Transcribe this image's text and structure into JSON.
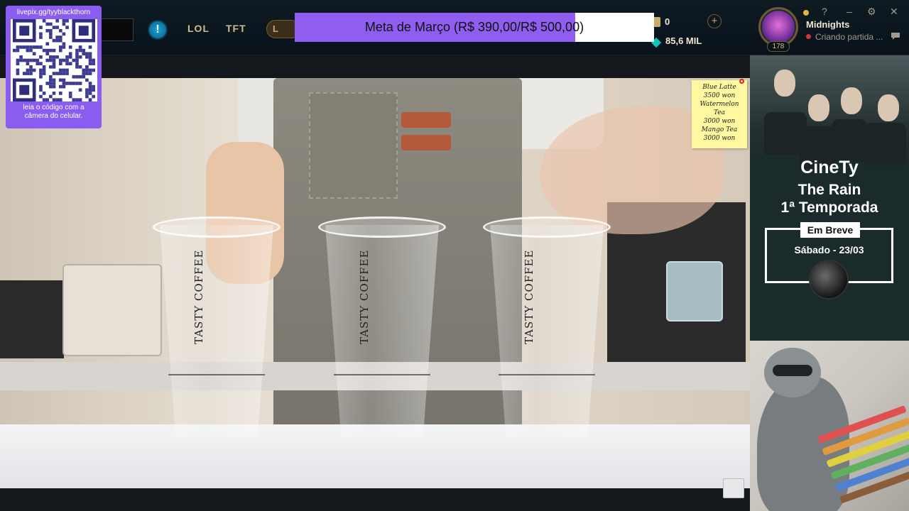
{
  "client": {
    "nav": {
      "lol": "LOL",
      "tft": "TFT",
      "pill_label": "L"
    },
    "info_icon": "info-icon",
    "currency": {
      "rp": "0",
      "blue_essence": "85,6 MIL",
      "add_label": "+"
    },
    "profile": {
      "name": "Midnights",
      "status": "Criando partida ...",
      "level": "178",
      "status_color": "#d13639"
    },
    "window_icons": {
      "help": "?",
      "minimize": "–",
      "settings": "⚙",
      "close": "✕"
    }
  },
  "goal": {
    "text": "Meta de Março (R$ 390,00/R$ 500,00)",
    "progress": 0.78,
    "fill_color": "#8f5df0"
  },
  "qr_widget": {
    "url": "livepix.gg/tyyblackthorn",
    "caption_line1": "leia o código com a",
    "caption_line2": "câmera do celular.",
    "color": "#8b5cf0"
  },
  "video": {
    "cups": [
      {
        "label": "TASTY COFFEE"
      },
      {
        "label": "TASTY COFFEE"
      },
      {
        "label": "TASTY COFFEE"
      }
    ],
    "price_note": [
      "Blue Latte",
      "3500 won",
      "Watermelon",
      "Tea",
      "3000 won",
      "Mango Tea",
      "3000 won"
    ]
  },
  "side_panel": {
    "brand": "CineTy",
    "title": "The Rain",
    "season": "1ª Temporada",
    "badge": "Em Breve",
    "date": "Sábado - 23/03"
  }
}
